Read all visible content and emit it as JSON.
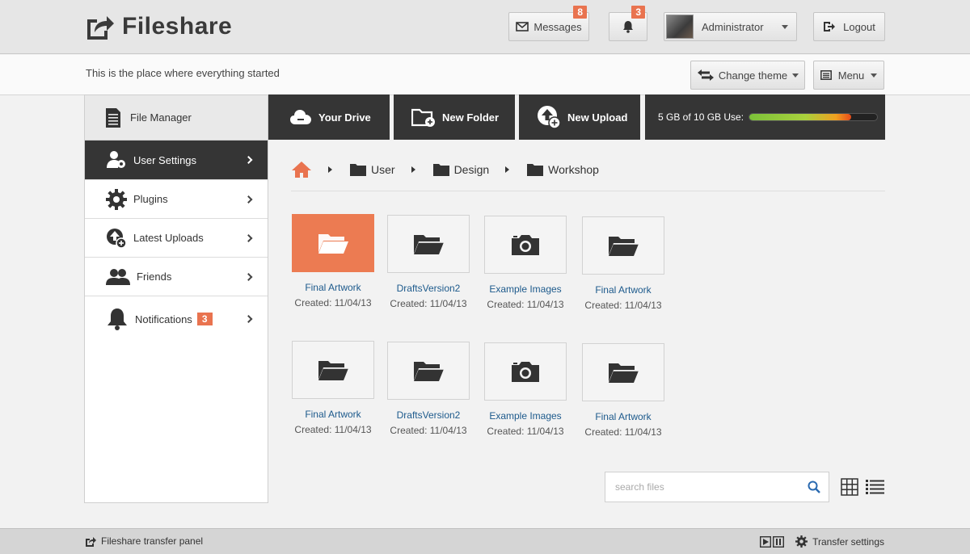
{
  "brand": {
    "name": "Fileshare"
  },
  "header": {
    "messages_label": "Messages",
    "messages_count": "8",
    "notifications_count": "3",
    "user_name": "Administrator",
    "logout_label": "Logout"
  },
  "subheader": {
    "tagline": "This is the place where everything started",
    "change_theme_label": "Change theme",
    "menu_label": "Menu"
  },
  "sidebar": {
    "title": "File Manager",
    "items": [
      {
        "label": "User Settings"
      },
      {
        "label": "Plugins"
      },
      {
        "label": "Latest Uploads"
      },
      {
        "label": "Friends"
      },
      {
        "label": "Notifications",
        "badge": "3"
      }
    ]
  },
  "toolbar": {
    "your_drive": "Your Drive",
    "new_folder": "New Folder",
    "new_upload": "New Upload",
    "storage_text": "5 GB of 10 GB Use:",
    "storage_fraction": 0.8
  },
  "breadcrumb": [
    "User",
    "Design",
    "Workshop"
  ],
  "files": [
    {
      "name": "Final Artwork",
      "date": "Created: 11/04/13",
      "icon": "open-folder-icon",
      "highlighted": true
    },
    {
      "name": "DraftsVersion2",
      "date": "Created: 11/04/13",
      "icon": "folder-icon"
    },
    {
      "name": "Example Images",
      "date": "Created: 11/04/13",
      "icon": "camera-icon"
    },
    {
      "name": "Final Artwork",
      "date": "Created: 11/04/13",
      "icon": "folder-icon"
    },
    {
      "name": "Final Artwork",
      "date": "Created: 11/04/13",
      "icon": "folder-icon"
    },
    {
      "name": "DraftsVersion2",
      "date": "Created: 11/04/13",
      "icon": "folder-icon"
    },
    {
      "name": "Example Images",
      "date": "Created: 11/04/13",
      "icon": "camera-icon"
    },
    {
      "name": "Final Artwork",
      "date": "Created: 11/04/13",
      "icon": "folder-icon"
    }
  ],
  "search": {
    "placeholder": "search files"
  },
  "footer": {
    "transfer_panel": "Fileshare transfer panel",
    "transfer_settings": "Transfer settings"
  },
  "colors": {
    "accent": "#e9734f",
    "dark": "#353535",
    "link": "#1d5a8c"
  }
}
